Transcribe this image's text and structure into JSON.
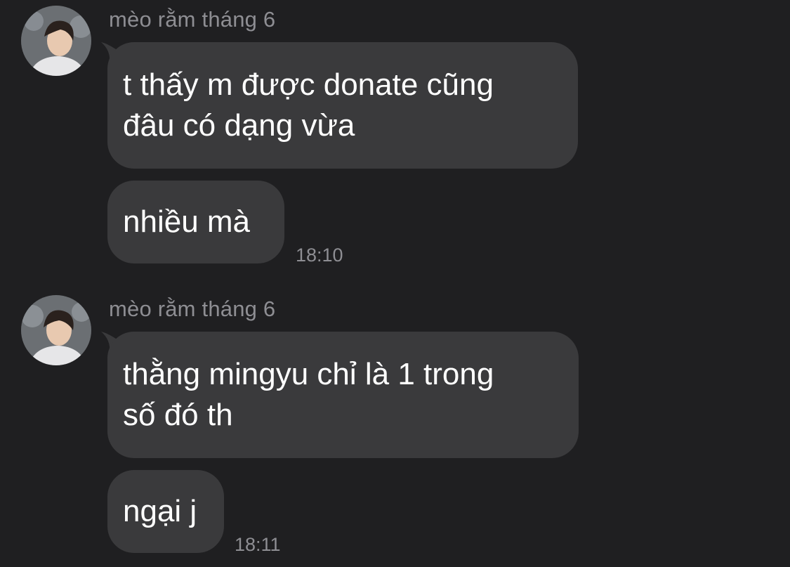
{
  "colors": {
    "background": "#1f1f21",
    "bubble": "#3a3a3c",
    "text": "#ffffff",
    "meta": "#8e8e93"
  },
  "messages": [
    {
      "sender": "mèo rằm tháng 6",
      "bubbles": [
        {
          "text": "t thấy m được donate cũng\nđâu có dạng vừa"
        },
        {
          "text": "nhiều mà",
          "time": "18:10"
        }
      ]
    },
    {
      "sender": "mèo rằm tháng 6",
      "bubbles": [
        {
          "text": "thằng mingyu chỉ là 1 trong\nsố đó th"
        },
        {
          "text": "ngại j",
          "time": "18:11"
        }
      ]
    }
  ]
}
